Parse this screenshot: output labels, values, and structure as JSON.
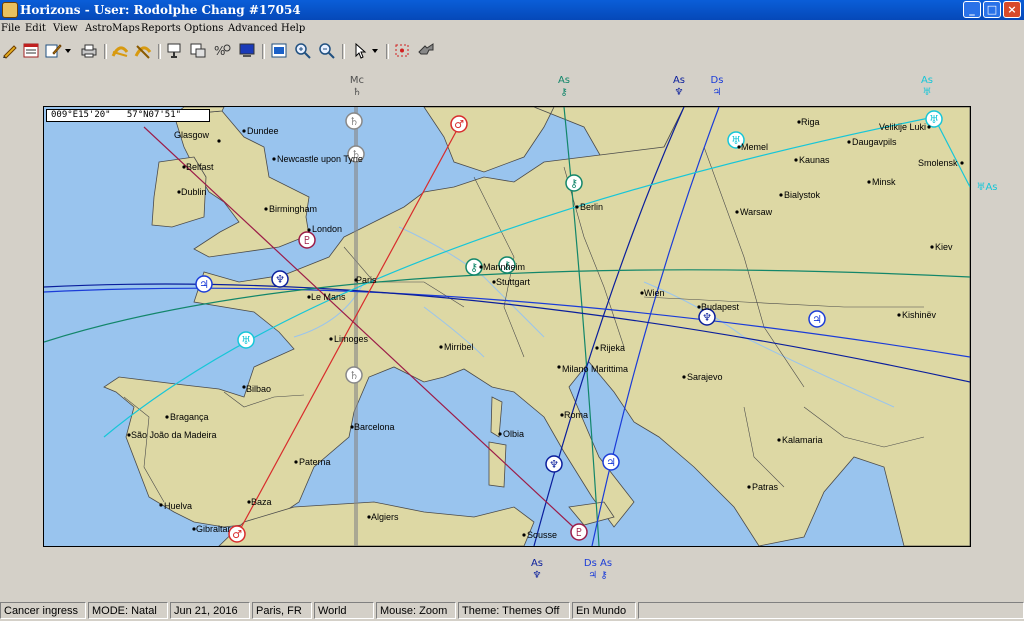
{
  "window": {
    "title": "Horizons - User: Rodolphe Chang #17054"
  },
  "menu": [
    "File",
    "Edit",
    "View",
    "AstroMaps",
    "Reports",
    "Options",
    "Advanced",
    "Help"
  ],
  "toolbar": [
    "new-chart-icon",
    "chart-list-icon",
    "edit-chart-icon",
    "dropdown-arrow-icon",
    "print-icon",
    "astromap-lines-icon",
    "astromap-zones-icon",
    "chart-wheel-icon",
    "chart-list-icon",
    "compare-icon",
    "screen-icon",
    "map-view-icon",
    "zoom-in-icon",
    "zoom-out-icon",
    "pointer-icon",
    "dropdown-arrow-icon",
    "select-area-icon",
    "relocate-icon"
  ],
  "coords": "009°E15'20\"   57°N07'51\"",
  "top_labels": [
    {
      "line1": "Mc",
      "line2": "♄"
    },
    {
      "line1": "As",
      "line2": "⚷"
    },
    {
      "line1": "As",
      "line2": "♆"
    },
    {
      "line1": "Ds",
      "line2": "♃"
    },
    {
      "line1": "As",
      "line2": "♅"
    }
  ],
  "bottom_labels": [
    {
      "line1": "As",
      "line2": "♆"
    },
    {
      "line1": "Ds As",
      "line2": "♃ ⚷"
    }
  ],
  "side_label": "♅As",
  "cities": [
    {
      "name": "Glasgow"
    },
    {
      "name": "Dundee"
    },
    {
      "name": "Belfast"
    },
    {
      "name": "Newcastle upon Tyne"
    },
    {
      "name": "Dublin"
    },
    {
      "name": "Birmingham"
    },
    {
      "name": "London"
    },
    {
      "name": "Le Mans"
    },
    {
      "name": "Paris"
    },
    {
      "name": "Limoges"
    },
    {
      "name": "Bilbao"
    },
    {
      "name": "Bragança"
    },
    {
      "name": "São João da Madeira"
    },
    {
      "name": "Barcelona"
    },
    {
      "name": "Paterna"
    },
    {
      "name": "Huelva"
    },
    {
      "name": "Baza"
    },
    {
      "name": "Gibraltar"
    },
    {
      "name": "Algiers"
    },
    {
      "name": "Stuttgart"
    },
    {
      "name": "Mannheim"
    },
    {
      "name": "Berlin"
    },
    {
      "name": "Memel"
    },
    {
      "name": "Riga"
    },
    {
      "name": "Velikije Luki"
    },
    {
      "name": "Daugavpils"
    },
    {
      "name": "Kaunas"
    },
    {
      "name": "Minsk"
    },
    {
      "name": "Smolensk"
    },
    {
      "name": "Bialystok"
    },
    {
      "name": "Warsaw"
    },
    {
      "name": "Kiev"
    },
    {
      "name": "Wien"
    },
    {
      "name": "Budapest"
    },
    {
      "name": "Kishinëv"
    },
    {
      "name": "Rijeka"
    },
    {
      "name": "Mirribel"
    },
    {
      "name": "Milano Marittima"
    },
    {
      "name": "Sarajevo"
    },
    {
      "name": "Roma"
    },
    {
      "name": "Olbia"
    },
    {
      "name": "Kalamaria"
    },
    {
      "name": "Patras"
    },
    {
      "name": "Sousse"
    }
  ],
  "status": [
    "Cancer ingress",
    "MODE: Natal",
    "Jun 21, 2016",
    "Paris, FR",
    "World",
    "Mouse: Zoom",
    "Theme: Themes Off",
    "En Mundo"
  ],
  "colors": {
    "sea": "#99c4ee",
    "land": "#ddd8a4",
    "saturn": "#888888",
    "neptune": "#0a1e9c",
    "jupiter": "#1b3cd8",
    "chiron": "#12866a",
    "uranus": "#16c6d8",
    "mars": "#d82c2c",
    "pluto": "#9c1c48",
    "title_bar": "#0a5ed8"
  }
}
